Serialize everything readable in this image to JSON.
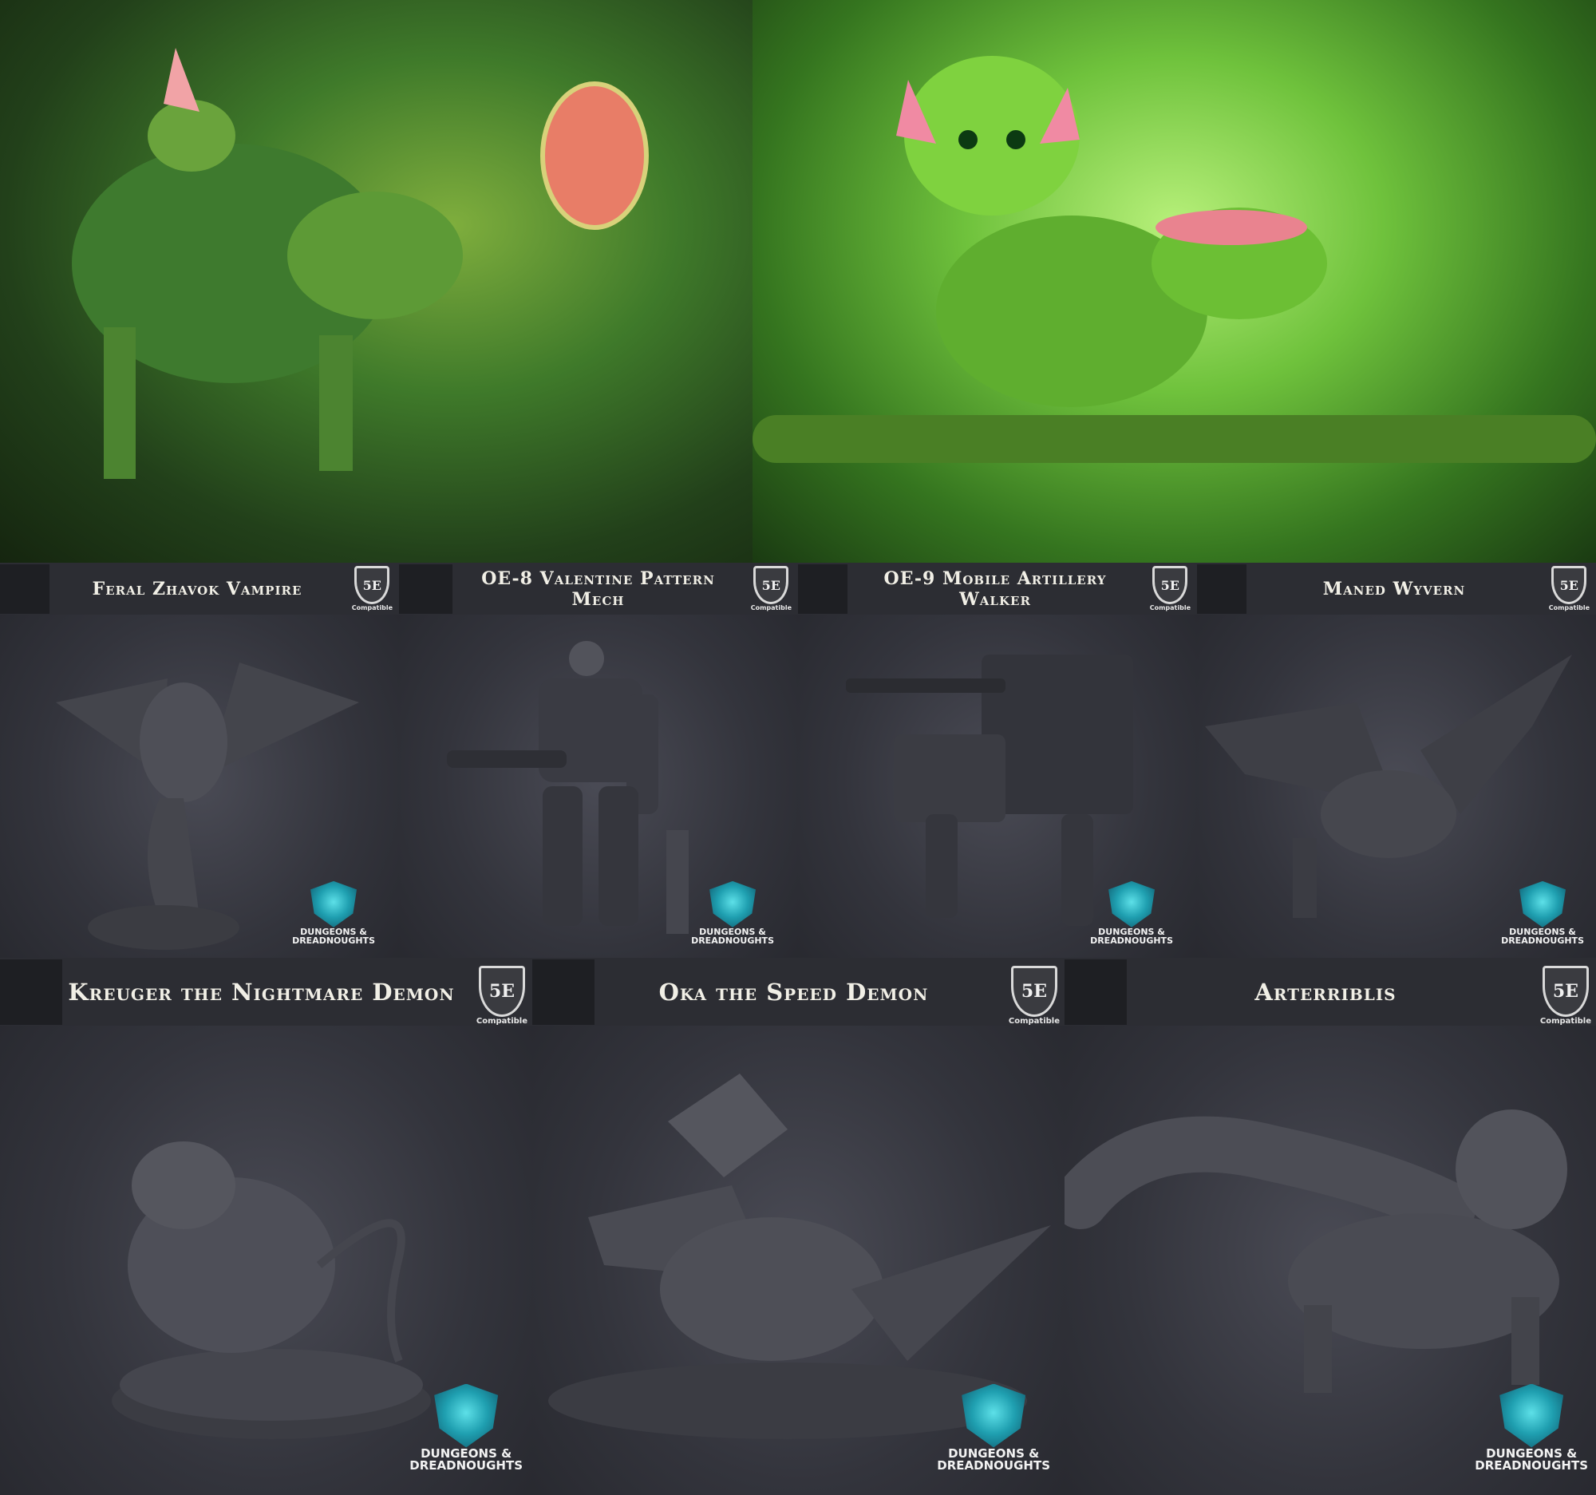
{
  "badge": {
    "edition": "5E",
    "compat": "Compatible"
  },
  "brand": {
    "line1": "DUNGEONS &",
    "line2": "DREADNOUGHTS"
  },
  "row1": [
    "Feral Zhavok Vampire",
    "OE-8 Valentine Pattern Mech",
    "OE-9 Mobile Artillery Walker",
    "Maned Wyvern"
  ],
  "row2": [
    "Kreuger the Nightmare Demon",
    "Oka the Speed Demon",
    "Arterriblis"
  ],
  "colors": {
    "bg": "#2a2b31",
    "title_text": "#f1efe6",
    "crest": "#1f9fb0"
  }
}
